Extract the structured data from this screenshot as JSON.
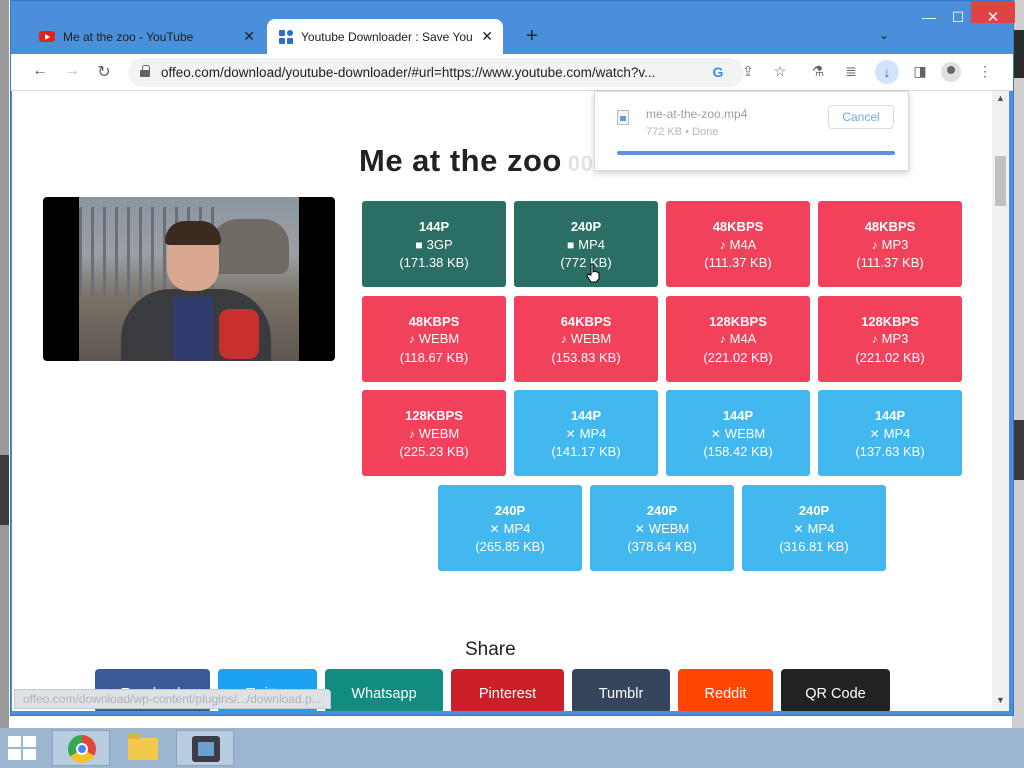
{
  "browser": {
    "tabs": [
      {
        "label": "Me at the zoo - YouTube",
        "icon": "youtube-icon"
      },
      {
        "label": "Youtube Downloader : Save Yout",
        "icon": "offeo-icon"
      }
    ],
    "new_tab": "+",
    "tab_search": "⌄",
    "window": {
      "minimize": "—",
      "maximize": "☐",
      "close": "✕"
    },
    "nav": {
      "back": "←",
      "forward": "→",
      "reload": "↻"
    },
    "url": "offeo.com/download/youtube-downloader/#url=https://www.youtube.com/watch?v...",
    "toolbar_icons": [
      "google-icon",
      "share-icon",
      "star-icon",
      "extension-icon",
      "media-icon",
      "download-icon",
      "sidepanel-icon",
      "profile-icon",
      "menu-icon"
    ]
  },
  "download_panel": {
    "filename": "me-at-the-zoo.mp4",
    "status": "772 KB • Done",
    "cancel_label": "Cancel",
    "progress": 1.0
  },
  "page": {
    "title": "Me at the zoo",
    "duration": "00:19",
    "formats": [
      {
        "quality": "144P",
        "icon": "video-icon",
        "container": "3GP",
        "size": "(171.38 KB)",
        "color": "#2b6e63"
      },
      {
        "quality": "240P",
        "icon": "video-icon",
        "container": "MP4",
        "size": "(772 KB)",
        "color": "#2b6e63"
      },
      {
        "quality": "48KBPS",
        "icon": "music-icon",
        "container": "M4A",
        "size": "(111.37 KB)",
        "color": "#f2415a"
      },
      {
        "quality": "48KBPS",
        "icon": "music-icon",
        "container": "MP3",
        "size": "(111.37 KB)",
        "color": "#f2415a"
      },
      {
        "quality": "48KBPS",
        "icon": "music-icon",
        "container": "WEBM",
        "size": "(118.67 KB)",
        "color": "#f2415a"
      },
      {
        "quality": "64KBPS",
        "icon": "music-icon",
        "container": "WEBM",
        "size": "(153.83 KB)",
        "color": "#f2415a"
      },
      {
        "quality": "128KBPS",
        "icon": "music-icon",
        "container": "M4A",
        "size": "(221.02 KB)",
        "color": "#f2415a"
      },
      {
        "quality": "128KBPS",
        "icon": "music-icon",
        "container": "MP3",
        "size": "(221.02 KB)",
        "color": "#f2415a"
      },
      {
        "quality": "128KBPS",
        "icon": "music-icon",
        "container": "WEBM",
        "size": "(225.23 KB)",
        "color": "#f2415a"
      },
      {
        "quality": "144P",
        "icon": "muted-icon",
        "container": "MP4",
        "size": "(141.17 KB)",
        "color": "#42b8ef"
      },
      {
        "quality": "144P",
        "icon": "muted-icon",
        "container": "WEBM",
        "size": "(158.42 KB)",
        "color": "#42b8ef"
      },
      {
        "quality": "144P",
        "icon": "muted-icon",
        "container": "MP4",
        "size": "(137.63 KB)",
        "color": "#42b8ef"
      },
      {
        "quality": "240P",
        "icon": "muted-icon",
        "container": "MP4",
        "size": "(265.85 KB)",
        "color": "#42b8ef"
      },
      {
        "quality": "240P",
        "icon": "muted-icon",
        "container": "WEBM",
        "size": "(378.64 KB)",
        "color": "#42b8ef"
      },
      {
        "quality": "240P",
        "icon": "muted-icon",
        "container": "MP4",
        "size": "(316.81 KB)",
        "color": "#42b8ef"
      }
    ],
    "share_heading": "Share",
    "share_buttons": [
      {
        "label": "Facebook",
        "color": "#3b5998"
      },
      {
        "label": "Twitter",
        "color": "#1da1f2"
      },
      {
        "label": "Whatsapp",
        "color": "#128c7e"
      },
      {
        "label": "Pinterest",
        "color": "#cb2027"
      },
      {
        "label": "Tumblr",
        "color": "#35465c"
      },
      {
        "label": "Reddit",
        "color": "#ff4500"
      },
      {
        "label": "QR Code",
        "color": "#222222"
      }
    ],
    "status_url": "offeo.com/download/wp-content/plugins/.../download.p..."
  },
  "taskbar": {
    "apps": [
      "start-icon",
      "chrome-icon",
      "file-explorer-icon",
      "movie-maker-icon"
    ]
  }
}
